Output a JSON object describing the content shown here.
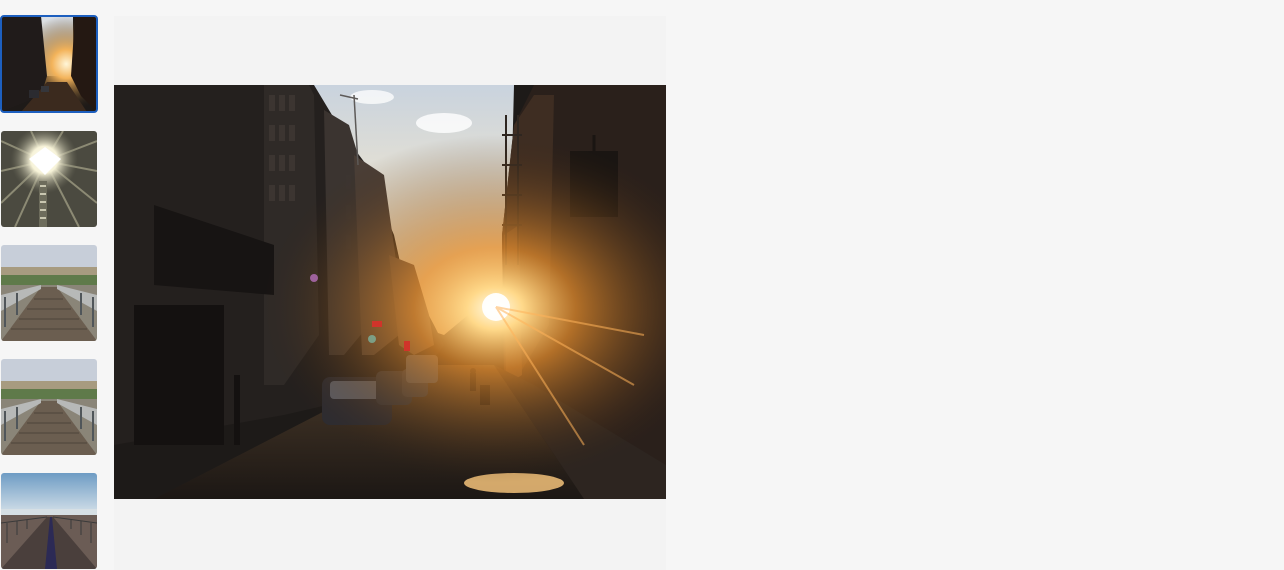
{
  "gallery": {
    "selected_index": 0,
    "thumbnails": [
      {
        "subject": "city-street-sunset",
        "selected": true
      },
      {
        "subject": "tunnel-skylight",
        "selected": false
      },
      {
        "subject": "wooden-boardwalk-bridge",
        "selected": false
      },
      {
        "subject": "wooden-boardwalk-bridge",
        "selected": false
      },
      {
        "subject": "pier-to-sea",
        "selected": false
      }
    ]
  },
  "viewer": {
    "image_subject": "city-street-sunset"
  },
  "colors": {
    "page_bg": "#f6f6f6",
    "viewer_bg": "#f3f3f3",
    "selection_border": "#1d5fbf"
  }
}
